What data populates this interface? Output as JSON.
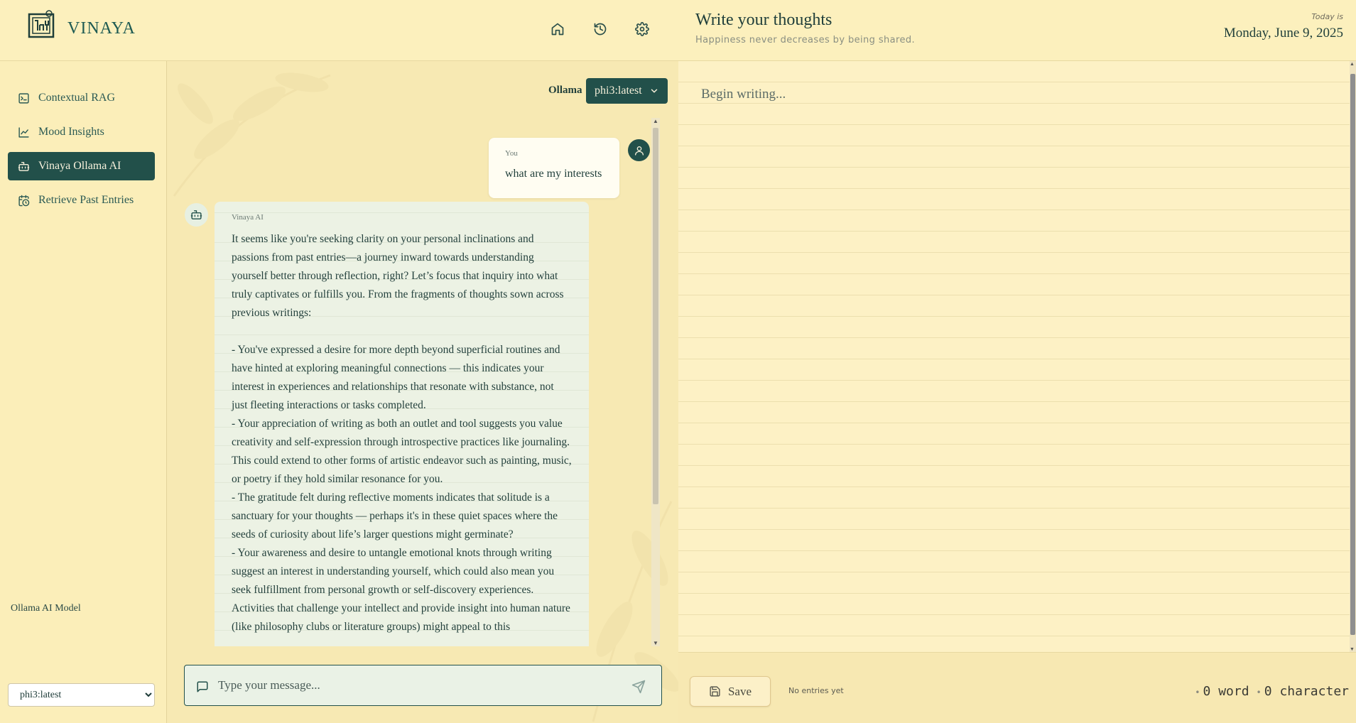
{
  "app": {
    "brand": "VINAYA"
  },
  "header": {
    "icons": [
      "home-icon",
      "history-icon",
      "settings-icon"
    ]
  },
  "sidebar": {
    "items": [
      {
        "label": "Contextual RAG",
        "icon": "document-icon",
        "active": false
      },
      {
        "label": "Mood Insights",
        "icon": "chart-line-icon",
        "active": false
      },
      {
        "label": "Vinaya Ollama AI",
        "icon": "bot-icon",
        "active": true
      },
      {
        "label": "Retrieve Past Entries",
        "icon": "calendar-clock-icon",
        "active": false
      }
    ],
    "model_label": "Ollama AI Model",
    "model_value": "phi3:latest"
  },
  "chat": {
    "provider_label": "Ollama",
    "provider_model": "phi3:latest",
    "user_message": {
      "sender": "You",
      "text": "what are my interests"
    },
    "bot_message": {
      "sender": "Vinaya AI",
      "text": "It seems like you're seeking clarity on your personal inclinations and passions from past entries—a journey inward towards understanding yourself better through reflection, right? Let’s focus that inquiry into what truly captivates or fulfills you. From the fragments of thoughts sown across previous writings:\n\n- You've expressed a desire for more depth beyond superficial routines and have hinted at exploring meaningful connections — this indicates your interest in experiences and relationships that resonate with substance, not just fleeting interactions or tasks completed.\n- Your appreciation of writing as both an outlet and tool suggests you value creativity and self-expression through introspective practices like journaling. This could extend to other forms of artistic endeavor such as painting, music, or poetry if they hold similar resonance for you.\n- The gratitude felt during reflective moments indicates that solitude is a sanctuary for your thoughts — perhaps it's in these quiet spaces where the seeds of curiosity about life’s larger questions might germinate?\n- Your awareness and desire to untangle emotional knots through writing suggest an interest in understanding yourself, which could also mean you seek fulfillment from personal growth or self-discovery experiences. Activities that challenge your intellect and provide insight into human nature (like philosophy clubs or literature groups) might appeal to this"
    },
    "input_placeholder": "Type your message..."
  },
  "journal": {
    "title": "Write your thoughts",
    "subtitle": "Happiness never decreases by being shared.",
    "today_label": "Today is",
    "date": "Monday, June 9, 2025",
    "placeholder": "Begin writing...",
    "save_label": "Save",
    "entries_status": "No entries yet",
    "word_count": "0 word",
    "char_count": "0 character"
  },
  "colors": {
    "accent": "#22504a",
    "background": "#fbeeb8",
    "bot_bubble": "#ecf2e4"
  }
}
